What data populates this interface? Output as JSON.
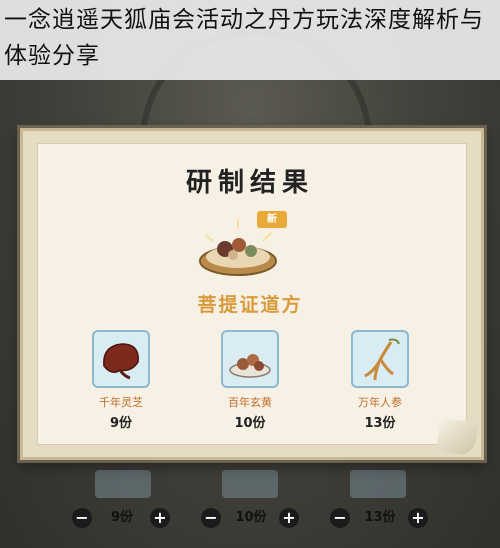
{
  "article": {
    "title": "一念逍遥天狐庙会活动之丹方玩法深度解析与体验分享"
  },
  "dialog": {
    "title": "研制结果",
    "new_badge": "新",
    "recipe_name": "菩提证道方",
    "ingredients": [
      {
        "name": "千年灵芝",
        "qty": "9份",
        "icon": "lingzhi-icon"
      },
      {
        "name": "百年玄黄",
        "qty": "10份",
        "icon": "xuanhuang-icon"
      },
      {
        "name": "万年人参",
        "qty": "13份",
        "icon": "ginseng-icon"
      }
    ]
  },
  "controls": [
    {
      "minus": "−",
      "qty": "9份",
      "plus": "+"
    },
    {
      "minus": "−",
      "qty": "10份",
      "plus": "+"
    },
    {
      "minus": "−",
      "qty": "13份",
      "plus": "+"
    }
  ],
  "colors": {
    "recipe_name": "#d89a3a",
    "ingredient_name": "#c06d2a",
    "icon_box": "#d9ecf3"
  }
}
